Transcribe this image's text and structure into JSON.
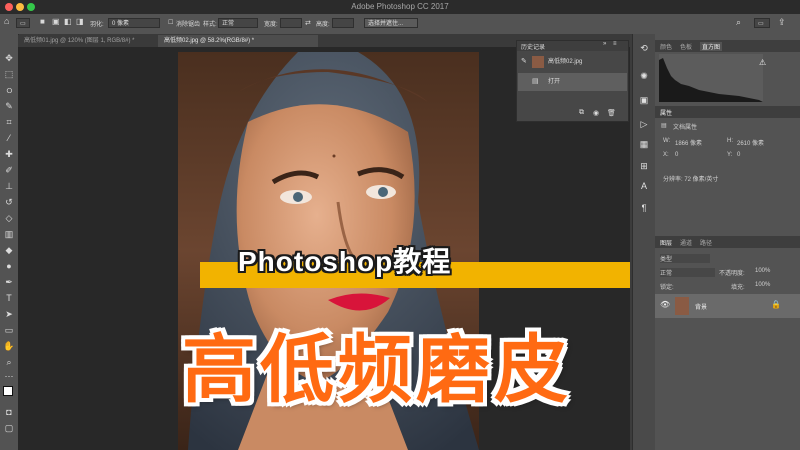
{
  "window": {
    "title": "Adobe Photoshop CC 2017"
  },
  "options_bar": {
    "feather_label": "羽化:",
    "feather_value": "0 像素",
    "antialias_label": "消除锯齿",
    "style_label": "样式:",
    "style_value": "正常",
    "width_label": "宽度:",
    "height_label": "高度:",
    "refine_label": "选择并遮住..."
  },
  "tabs": [
    {
      "label": "高低频01.jpg @ 120% (图层 1, RGB/8#) *"
    },
    {
      "label": "高低频02.jpg @ 58.2%(RGB/8#) *"
    }
  ],
  "history_panel": {
    "tab_label": "历史记录",
    "snapshot_name": "高低频02.jpg",
    "step_open": "打开"
  },
  "right_top_panel": {
    "tabs": [
      "颜色",
      "色板",
      "直方图"
    ],
    "warning": "⚠"
  },
  "properties_panel": {
    "title": "属性",
    "doc_props": "文档属性",
    "w_label": "W:",
    "w_value": "1866 像素",
    "h_label": "H:",
    "h_value": "2610 像素",
    "x_label": "X:",
    "x_value": "0",
    "y_label": "Y:",
    "y_value": "0",
    "resolution": "分辨率: 72 像素/英寸"
  },
  "layers_panel": {
    "tabs": [
      "图层",
      "通道",
      "路径"
    ],
    "kind_label": "类型",
    "mode_value": "正常",
    "opacity_label": "不透明度:",
    "opacity_value": "100%",
    "lock_label": "锁定:",
    "fill_label": "填充:",
    "fill_value": "100%",
    "layer_name": "背景"
  },
  "overlay": {
    "banner": "Photoshop教程",
    "title": "高低频磨皮"
  },
  "colors": {
    "banner_yellow": "#f2b300",
    "title_orange": "#ff6a12"
  }
}
